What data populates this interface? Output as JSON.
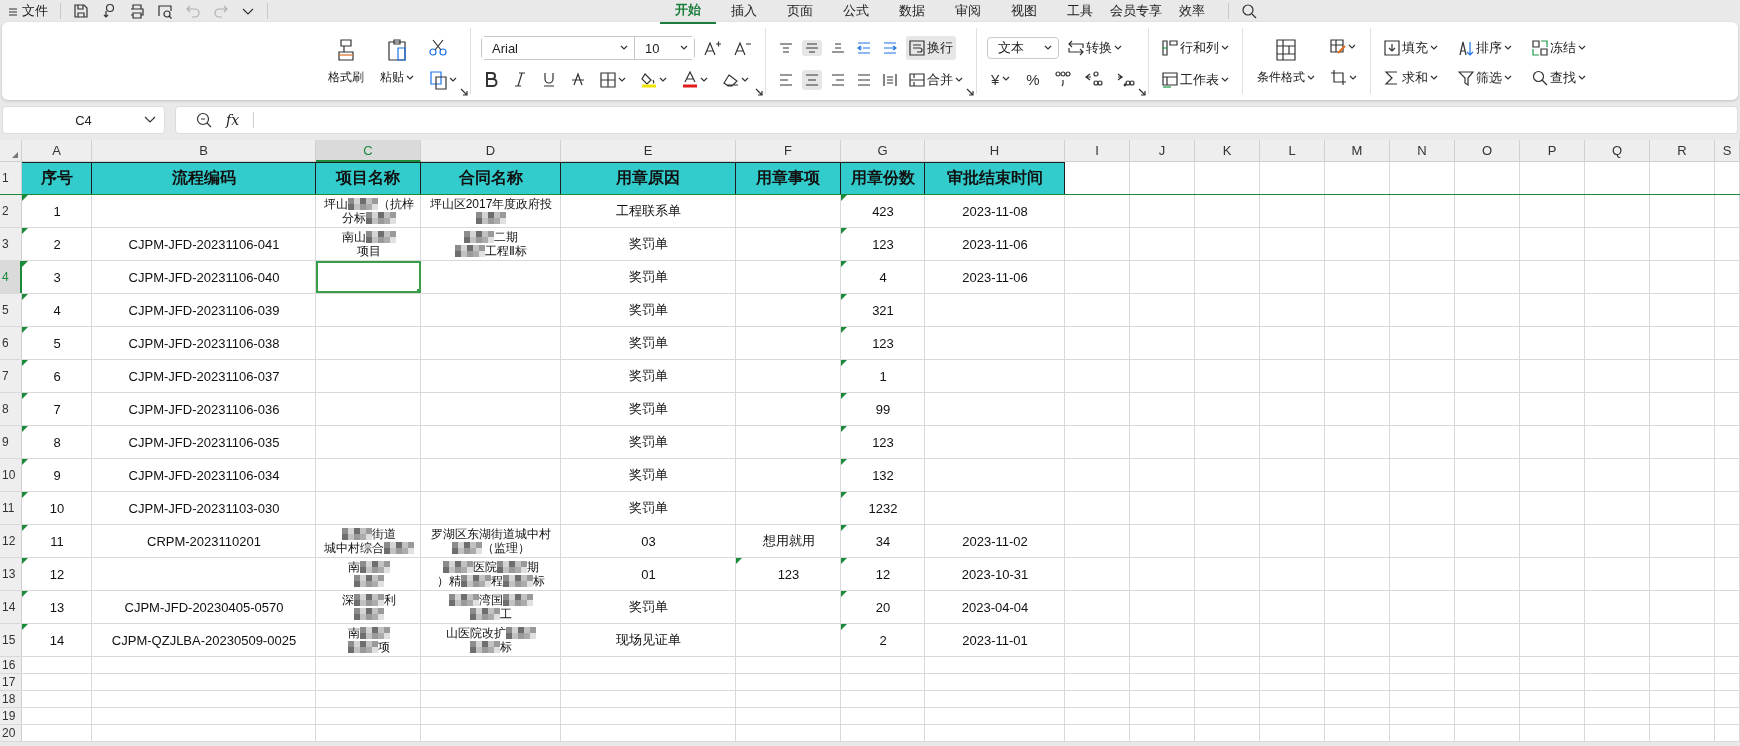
{
  "menu": {
    "file": "文件",
    "tabs": [
      {
        "label": "开始",
        "selected": true
      },
      {
        "label": "插入",
        "selected": false
      },
      {
        "label": "页面",
        "selected": false
      },
      {
        "label": "公式",
        "selected": false
      },
      {
        "label": "数据",
        "selected": false
      },
      {
        "label": "审阅",
        "selected": false
      },
      {
        "label": "视图",
        "selected": false
      },
      {
        "label": "工具",
        "selected": false
      },
      {
        "label": "会员专享",
        "selected": false
      },
      {
        "label": "效率",
        "selected": false
      }
    ]
  },
  "ribbon": {
    "clipboard": {
      "format_painter": "格式刷",
      "paste": "粘贴"
    },
    "font": {
      "name": "Arial",
      "size": "10"
    },
    "alignment": {
      "buttons": [
        {
          "kind": "top",
          "selected": false
        },
        {
          "kind": "middle",
          "selected": true
        },
        {
          "kind": "bottom",
          "selected": false
        },
        {
          "kind": "outdent",
          "selected": false
        },
        {
          "kind": "indent",
          "selected": false
        },
        {
          "kind": "left",
          "selected": false
        },
        {
          "kind": "center",
          "selected": true
        },
        {
          "kind": "right",
          "selected": false
        },
        {
          "kind": "justify",
          "selected": false
        },
        {
          "kind": "distribute",
          "selected": false
        }
      ],
      "wrap": {
        "label": "换行",
        "selected": true
      },
      "merge": "合并"
    },
    "number": {
      "format": "文本",
      "convert": "转换",
      "currency": "¥",
      "percent": "%"
    },
    "cells": {
      "rows_cols": "行和列",
      "worksheet": "工作表",
      "conditional": "条件格式"
    },
    "editing": [
      "填充",
      "排序",
      "冻结",
      "求和",
      "筛选",
      "查找"
    ]
  },
  "formula_bar": {
    "cell_ref": "C4",
    "fx": "fx"
  },
  "sheet": {
    "columns": [
      {
        "label": "A",
        "selected": false
      },
      {
        "label": "B",
        "selected": false
      },
      {
        "label": "C",
        "selected": true
      },
      {
        "label": "D",
        "selected": false
      },
      {
        "label": "E",
        "selected": false
      },
      {
        "label": "F",
        "selected": false
      },
      {
        "label": "G",
        "selected": false
      },
      {
        "label": "H",
        "selected": false
      },
      {
        "label": "I",
        "selected": false
      },
      {
        "label": "J",
        "selected": false
      },
      {
        "label": "K",
        "selected": false
      },
      {
        "label": "L",
        "selected": false
      },
      {
        "label": "M",
        "selected": false
      },
      {
        "label": "N",
        "selected": false
      },
      {
        "label": "O",
        "selected": false
      },
      {
        "label": "P",
        "selected": false
      },
      {
        "label": "Q",
        "selected": false
      },
      {
        "label": "R",
        "selected": false
      },
      {
        "label": "S",
        "selected": false
      }
    ],
    "rows": [
      {
        "label": "1",
        "kind": "header",
        "selected": false,
        "cells": [
          "序号",
          "流程编码",
          "项目名称",
          "合同名称",
          "用章原因",
          "用章事项",
          "用章份数",
          "审批结束时间"
        ]
      },
      {
        "label": "2",
        "kind": "data",
        "selected": false,
        "cells": [
          {
            "text": "1",
            "flag": true
          },
          null,
          {
            "lines": [
              [
                "坪山",
                {
                  "kind": "mosaic"
                },
                "（抗梓"
              ],
              [
                "分标",
                {
                  "kind": "mosaic"
                }
              ]
            ]
          },
          {
            "lines": [
              [
                "坪山区2017年度政府投"
              ],
              [
                {
                  "kind": "mosaic"
                }
              ]
            ]
          },
          "工程联系单",
          null,
          {
            "text": "423",
            "flag": true
          },
          "2023-11-08"
        ]
      },
      {
        "label": "3",
        "kind": "data",
        "selected": false,
        "cells": [
          {
            "text": "2",
            "flag": true
          },
          "CJPM-JFD-20231106-041",
          {
            "lines": [
              [
                "南山",
                {
                  "kind": "mosaic"
                }
              ],
              [
                "项目"
              ]
            ]
          },
          {
            "lines": [
              [
                {
                  "kind": "mosaic"
                },
                "二期"
              ],
              [
                {
                  "kind": "mosaic"
                },
                "工程Ⅱ标"
              ]
            ]
          },
          "奖罚单",
          null,
          {
            "text": "123",
            "flag": true
          },
          "2023-11-06"
        ]
      },
      {
        "label": "4",
        "kind": "data",
        "selected": true,
        "cells": [
          {
            "text": "3",
            "flag": true
          },
          "CJPM-JFD-20231106-040",
          null,
          null,
          "奖罚单",
          null,
          {
            "text": "4",
            "flag": true
          },
          "2023-11-06"
        ]
      },
      {
        "label": "5",
        "kind": "data",
        "selected": false,
        "cells": [
          {
            "text": "4",
            "flag": true
          },
          "CJPM-JFD-20231106-039",
          null,
          null,
          "奖罚单",
          null,
          {
            "text": "321",
            "flag": true
          },
          null
        ]
      },
      {
        "label": "6",
        "kind": "data",
        "selected": false,
        "cells": [
          {
            "text": "5",
            "flag": true
          },
          "CJPM-JFD-20231106-038",
          null,
          null,
          "奖罚单",
          null,
          {
            "text": "123",
            "flag": true
          },
          null
        ]
      },
      {
        "label": "7",
        "kind": "data",
        "selected": false,
        "cells": [
          {
            "text": "6",
            "flag": true
          },
          "CJPM-JFD-20231106-037",
          null,
          null,
          "奖罚单",
          null,
          {
            "text": "1",
            "flag": true
          },
          null
        ]
      },
      {
        "label": "8",
        "kind": "data",
        "selected": false,
        "cells": [
          {
            "text": "7",
            "flag": true
          },
          "CJPM-JFD-20231106-036",
          null,
          null,
          "奖罚单",
          null,
          {
            "text": "99",
            "flag": true
          },
          null
        ]
      },
      {
        "label": "9",
        "kind": "data",
        "selected": false,
        "cells": [
          {
            "text": "8",
            "flag": true
          },
          "CJPM-JFD-20231106-035",
          null,
          null,
          "奖罚单",
          null,
          {
            "text": "123",
            "flag": true
          },
          null
        ]
      },
      {
        "label": "10",
        "kind": "data",
        "selected": false,
        "cells": [
          {
            "text": "9",
            "flag": true
          },
          "CJPM-JFD-20231106-034",
          null,
          null,
          "奖罚单",
          null,
          {
            "text": "132",
            "flag": true
          },
          null
        ]
      },
      {
        "label": "11",
        "kind": "data",
        "selected": false,
        "cells": [
          {
            "text": "10",
            "flag": true
          },
          "CJPM-JFD-20231103-030",
          null,
          null,
          "奖罚单",
          null,
          {
            "text": "1232",
            "flag": true
          },
          null
        ]
      },
      {
        "label": "12",
        "kind": "data",
        "selected": false,
        "cells": [
          {
            "text": "11",
            "flag": true
          },
          "CRPM-2023110201",
          {
            "lines": [
              [
                {
                  "kind": "mosaic"
                },
                "街道"
              ],
              [
                "城中村综合",
                {
                  "kind": "mosaic"
                }
              ]
            ]
          },
          {
            "lines": [
              [
                "罗湖区东湖街道城中村"
              ],
              [
                {
                  "kind": "mosaic"
                },
                "（监理）"
              ]
            ]
          },
          "03",
          "想用就用",
          {
            "text": "34",
            "flag": true
          },
          "2023-11-02"
        ]
      },
      {
        "label": "13",
        "kind": "data",
        "selected": false,
        "cells": [
          {
            "text": "12",
            "flag": true
          },
          null,
          {
            "lines": [
              [
                "南",
                {
                  "kind": "mosaic"
                }
              ],
              [
                {
                  "kind": "mosaic"
                }
              ]
            ]
          },
          {
            "lines": [
              [
                {
                  "kind": "mosaic"
                },
                "医院",
                {
                  "kind": "mosaic"
                },
                "期"
              ],
              [
                "）精",
                {
                  "kind": "mosaic"
                },
                "程",
                {
                  "kind": "mosaic"
                },
                "标"
              ]
            ]
          },
          "01",
          {
            "text": "123",
            "flag": true
          },
          {
            "text": "12",
            "flag": true
          },
          "2023-10-31"
        ]
      },
      {
        "label": "14",
        "kind": "data",
        "selected": false,
        "cells": [
          {
            "text": "13",
            "flag": true
          },
          "CJPM-JFD-20230405-0570",
          {
            "lines": [
              [
                "深",
                {
                  "kind": "mosaic"
                },
                "利"
              ],
              [
                {
                  "kind": "mosaic"
                }
              ]
            ]
          },
          {
            "lines": [
              [
                {
                  "kind": "mosaic"
                },
                "湾国",
                {
                  "kind": "mosaic"
                }
              ],
              [
                {
                  "kind": "mosaic"
                },
                "工"
              ]
            ]
          },
          "奖罚单",
          null,
          {
            "text": "20",
            "flag": true
          },
          "2023-04-04"
        ]
      },
      {
        "label": "15",
        "kind": "data",
        "selected": false,
        "cells": [
          {
            "text": "14",
            "flag": true
          },
          "CJPM-QZJLBA-20230509-0025",
          {
            "lines": [
              [
                "南",
                {
                  "kind": "mosaic"
                }
              ],
              [
                {
                  "kind": "mosaic"
                },
                "项"
              ]
            ]
          },
          {
            "lines": [
              [
                "山医院改扩",
                {
                  "kind": "mosaic"
                }
              ],
              [
                {
                  "kind": "mosaic"
                },
                "标"
              ]
            ]
          },
          "现场见证单",
          null,
          {
            "text": "2",
            "flag": true
          },
          "2023-11-01"
        ]
      },
      {
        "label": "16",
        "kind": "blank",
        "selected": false
      },
      {
        "label": "17",
        "kind": "blank",
        "selected": false
      },
      {
        "label": "18",
        "kind": "blank",
        "selected": false
      },
      {
        "label": "19",
        "kind": "blank",
        "selected": false
      },
      {
        "label": "20",
        "kind": "blank",
        "selected": false
      }
    ]
  }
}
